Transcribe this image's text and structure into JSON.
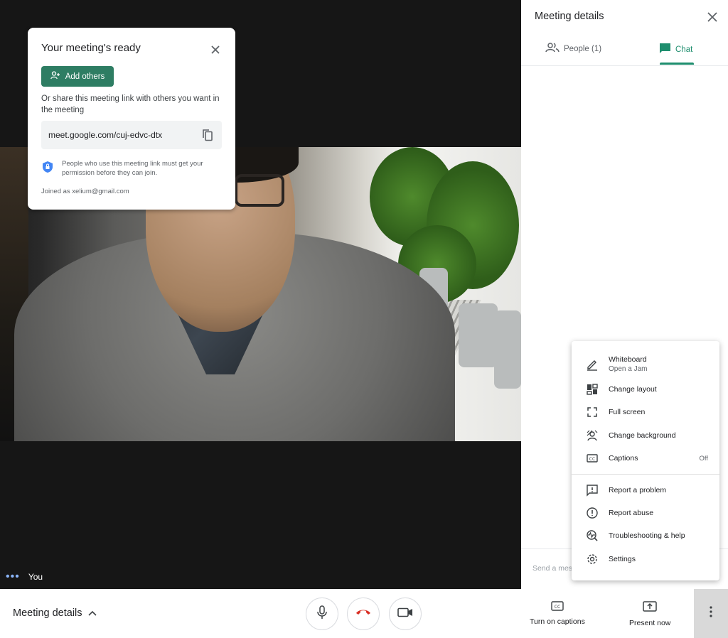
{
  "stage": {
    "self_label": "You"
  },
  "ready_card": {
    "title": "Your meeting's ready",
    "add_others": "Add others",
    "share_text": "Or share this meeting link with others you want in the meeting",
    "link": "meet.google.com/cuj-edvc-dtx",
    "permission_note": "People who use this meeting link must get your permission before they can join.",
    "joined_as": "Joined as xelium@gmail.com"
  },
  "panel": {
    "title": "Meeting details",
    "tabs": [
      {
        "label": "People (1)",
        "icon": "people-icon",
        "active": false
      },
      {
        "label": "Chat",
        "icon": "chat-icon",
        "active": true
      }
    ],
    "send_placeholder": "Send a mes"
  },
  "menu": {
    "items": [
      {
        "label": "Whiteboard",
        "sublabel": "Open a Jam",
        "icon": "pencil-icon"
      },
      {
        "label": "Change layout",
        "icon": "layout-icon"
      },
      {
        "label": "Full screen",
        "icon": "fullscreen-icon"
      },
      {
        "label": "Change background",
        "icon": "background-icon"
      },
      {
        "label": "Captions",
        "value": "Off",
        "icon": "captions-icon"
      },
      {
        "label": "Report a problem",
        "icon": "report-problem-icon"
      },
      {
        "label": "Report abuse",
        "icon": "report-abuse-icon"
      },
      {
        "label": "Troubleshooting & help",
        "icon": "troubleshoot-icon"
      },
      {
        "label": "Settings",
        "icon": "gear-icon"
      }
    ]
  },
  "bottom_bar": {
    "meeting_details": "Meeting details",
    "captions": "Turn on captions",
    "present": "Present now"
  },
  "colors": {
    "accent": "#1e8e6e",
    "add_button": "#2e7d63",
    "hangup": "#d93025"
  }
}
